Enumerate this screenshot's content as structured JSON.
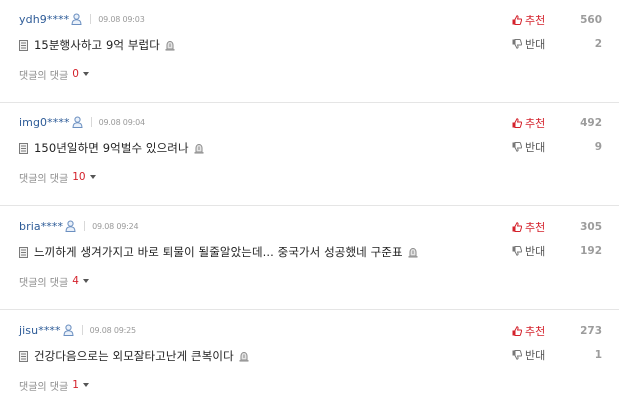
{
  "icons": {
    "user": "user-icon",
    "document": "document-icon",
    "report": "siren-icon",
    "thumbs_up": "thumbs-up-icon",
    "thumbs_down": "thumbs-down-icon",
    "caret": "caret-down-icon"
  },
  "colors": {
    "username": "#2d5b97",
    "upvote": "#d4212b",
    "reply_count": "#d4212b",
    "muted": "#8a8a8a",
    "vote_count": "#9c9c9c"
  },
  "labels": {
    "upvote": "추천",
    "downvote": "반대",
    "replies": "댓글의 댓글"
  },
  "comments": [
    {
      "username": "ydh9",
      "masked": "****",
      "timestamp": "09.08 09:03",
      "text": "15분행사하고 9억 부럽다",
      "reply_count": "0",
      "up_count": "560",
      "down_count": "2"
    },
    {
      "username": "img0",
      "masked": "****",
      "timestamp": "09.08 09:04",
      "text": "150년일하면 9억벌수 있으려나",
      "reply_count": "10",
      "up_count": "492",
      "down_count": "9"
    },
    {
      "username": "bria",
      "masked": "****",
      "timestamp": "09.08 09:24",
      "text": "느끼하게 생겨가지고 바로 퇴물이 될줄알았는데... 중국가서 성공했네 구준표",
      "reply_count": "4",
      "up_count": "305",
      "down_count": "192"
    },
    {
      "username": "jisu",
      "masked": "****",
      "timestamp": "09.08 09:25",
      "text": "건강다음으로는 외모잘타고난게 큰복이다",
      "reply_count": "1",
      "up_count": "273",
      "down_count": "1"
    }
  ]
}
